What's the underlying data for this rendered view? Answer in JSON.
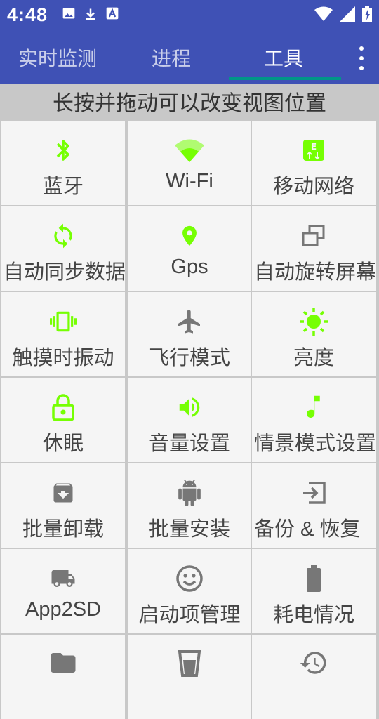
{
  "status_bar": {
    "time": "4:48",
    "left_icons": [
      "image-icon",
      "download-icon",
      "font-a-icon"
    ],
    "right_icons": [
      "wifi-icon",
      "signal-icon",
      "battery-icon"
    ]
  },
  "app_bar": {
    "tabs": [
      {
        "label": "实时监测",
        "active": false
      },
      {
        "label": "进程",
        "active": false
      },
      {
        "label": "工具",
        "active": true
      }
    ],
    "overflow_icon": "more-vert-icon",
    "color": "#3f51b5",
    "indicator_color": "#009688"
  },
  "hint": "长按并拖动可以改变视图位置",
  "colors": {
    "active_icon": "#76ff03",
    "inactive_icon": "#777777"
  },
  "tools": [
    {
      "label": "蓝牙",
      "icon": "bluetooth-icon",
      "active": true
    },
    {
      "label": "Wi-Fi",
      "icon": "wifi-icon",
      "active": true
    },
    {
      "label": "移动网络",
      "icon": "mobile-data-icon",
      "active": true
    },
    {
      "label": "自动同步数据",
      "icon": "sync-icon",
      "active": true
    },
    {
      "label": "Gps",
      "icon": "location-pin-icon",
      "active": true
    },
    {
      "label": "自动旋转屏幕",
      "icon": "rotate-screen-icon",
      "active": false
    },
    {
      "label": "触摸时振动",
      "icon": "vibrate-icon",
      "active": true
    },
    {
      "label": "飞行模式",
      "icon": "airplane-icon",
      "active": false
    },
    {
      "label": "亮度",
      "icon": "brightness-icon",
      "active": true
    },
    {
      "label": "休眠",
      "icon": "lock-icon",
      "active": true
    },
    {
      "label": "音量设置",
      "icon": "volume-icon",
      "active": true
    },
    {
      "label": "情景模式设置",
      "icon": "music-note-icon",
      "active": true
    },
    {
      "label": "批量卸载",
      "icon": "archive-icon",
      "active": false
    },
    {
      "label": "批量安装",
      "icon": "android-icon",
      "active": false
    },
    {
      "label": "备份 & 恢复",
      "icon": "import-icon",
      "active": false
    },
    {
      "label": "App2SD",
      "icon": "truck-icon",
      "active": false
    },
    {
      "label": "启动项管理",
      "icon": "smiley-icon",
      "active": false
    },
    {
      "label": "耗电情况",
      "icon": "battery-full-icon",
      "active": false
    },
    {
      "label": "",
      "icon": "folder-icon",
      "active": false
    },
    {
      "label": "",
      "icon": "cup-icon",
      "active": false
    },
    {
      "label": "",
      "icon": "history-icon",
      "active": false
    }
  ]
}
